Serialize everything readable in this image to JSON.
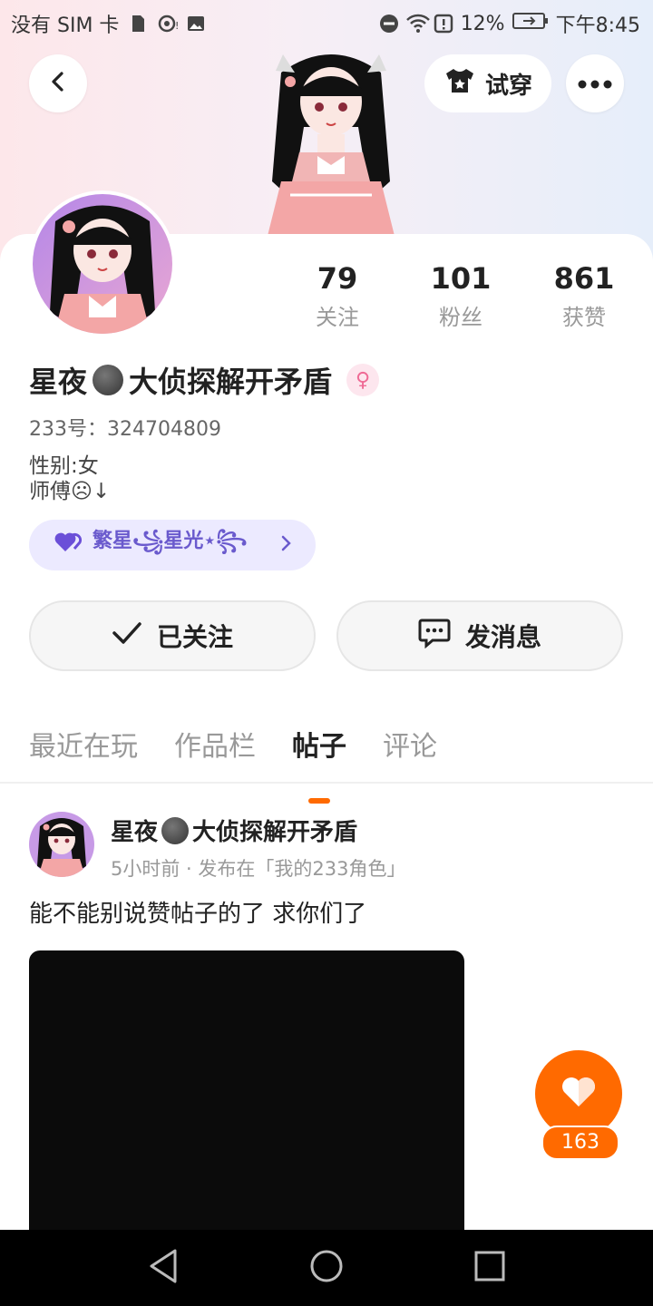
{
  "status_bar": {
    "carrier": "没有 SIM 卡",
    "battery": "12%",
    "time": "下午8:45",
    "icons": [
      "sd-card-icon",
      "hotspot-icon",
      "image-icon",
      "dnd-icon",
      "wifi-icon",
      "alert-icon",
      "battery-icon"
    ]
  },
  "header": {
    "try_on_label": "试穿",
    "icons": [
      "back-icon",
      "shirt-icon",
      "more-icon"
    ]
  },
  "profile": {
    "name": "星夜",
    "name_suffix": "大侦探解开矛盾",
    "gender_symbol": "♀",
    "uid": "233号：324704809",
    "bio_line1": "性别:女",
    "bio_line2": "师傅☹↓",
    "tag_label": "繁星꧁星光⋆꧂",
    "stats": [
      {
        "value": "79",
        "label": "关注"
      },
      {
        "value": "101",
        "label": "粉丝"
      },
      {
        "value": "861",
        "label": "获赞"
      }
    ]
  },
  "actions": {
    "followed_label": "已关注",
    "message_label": "发消息"
  },
  "tabs": [
    {
      "label": "最近在玩",
      "active": false
    },
    {
      "label": "作品栏",
      "active": false
    },
    {
      "label": "帖子",
      "active": true
    },
    {
      "label": "评论",
      "active": false
    }
  ],
  "post": {
    "author": "星夜",
    "author_suffix": "大侦探解开矛盾",
    "meta": "5小时前 · 发布在「我的233角色」",
    "text": "能不能别说赞帖子的了 求你们了",
    "like_count": "163"
  },
  "colors": {
    "accent": "#ff6a00",
    "tag_bg": "#eceaff",
    "tag_text": "#6a5acd",
    "gender": "#ef6a95"
  }
}
